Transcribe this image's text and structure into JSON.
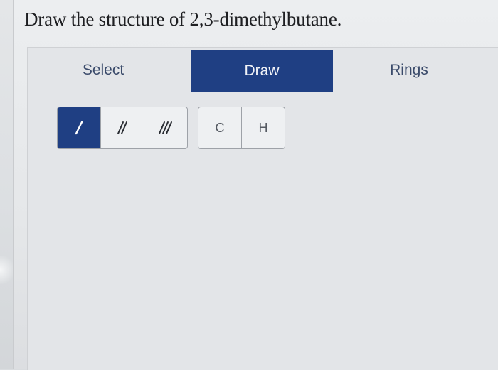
{
  "question": {
    "text": "Draw the structure of 2,3-dimethylbutane."
  },
  "mode_tabs": {
    "select_label": "Select",
    "draw_label": "Draw",
    "rings_label": "Rings",
    "active": "Draw"
  },
  "bond_tools": [
    {
      "name": "single-bond",
      "active": true
    },
    {
      "name": "double-bond",
      "active": false
    },
    {
      "name": "triple-bond",
      "active": false
    }
  ],
  "atom_tools": {
    "carbon_label": "C",
    "hydrogen_label": "H"
  },
  "colors": {
    "accent": "#1f3f83",
    "tab_text": "#3a4a6a"
  }
}
